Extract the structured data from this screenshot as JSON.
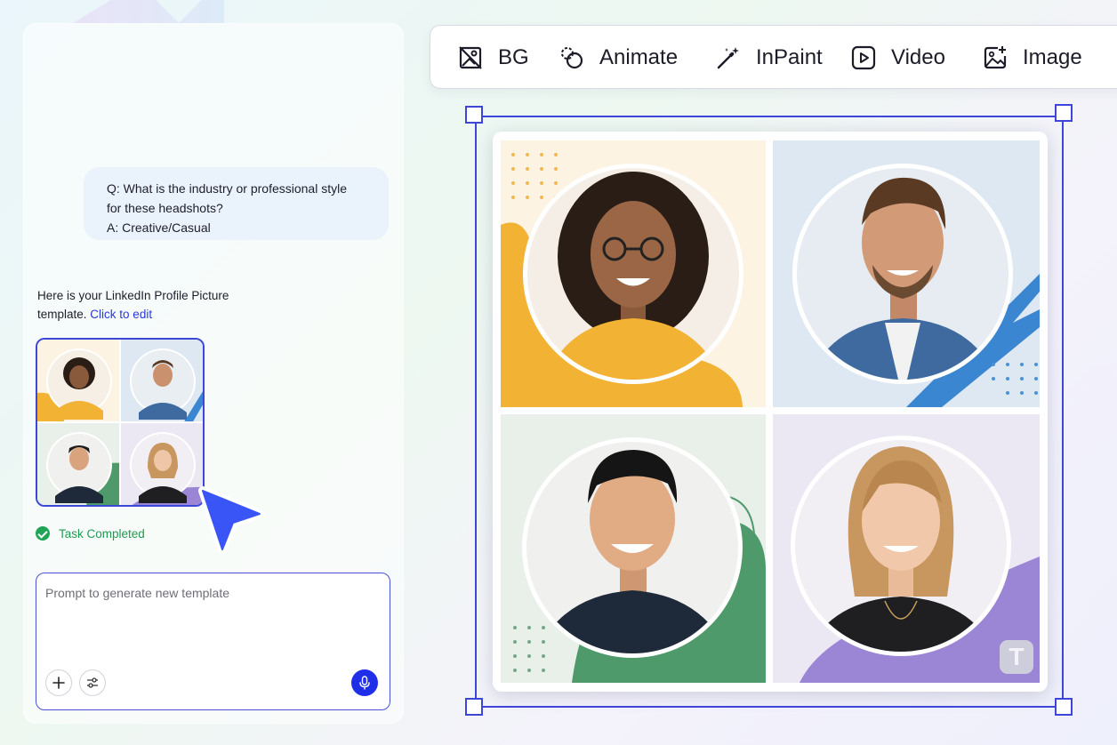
{
  "chat": {
    "question_line1": "Q: What is the industry or professional style",
    "question_line2": "for these headshots?",
    "answer_line": "A: Creative/Casual",
    "reply_line1": "Here is your LinkedIn Profile Picture",
    "reply_line2_prefix": "template.",
    "reply_link": "Click to edit",
    "task_status": "Task Completed",
    "prompt_placeholder": "Prompt to generate new template"
  },
  "toolbar": {
    "tools": [
      {
        "label": "BG",
        "icon": "background-remove-icon"
      },
      {
        "label": "Animate",
        "icon": "animate-icon"
      },
      {
        "label": "InPaint",
        "icon": "magic-wand-icon"
      },
      {
        "label": "Video",
        "icon": "video-play-icon"
      },
      {
        "label": "Image",
        "icon": "image-add-icon"
      }
    ]
  },
  "canvas": {
    "watermark_letter": "T",
    "portraits": [
      {
        "position": "top-left",
        "background": "#fdf3e3",
        "accent": "#f2b233"
      },
      {
        "position": "top-right",
        "background": "#dde8f3",
        "accent": "#3b86d1"
      },
      {
        "position": "bottom-left",
        "background": "#e9efe9",
        "accent": "#4f9a6b"
      },
      {
        "position": "bottom-right",
        "background": "#ebe7f3",
        "accent": "#9b86d6"
      }
    ]
  },
  "colors": {
    "accent": "#3e46d9",
    "mic_button": "#1f2ee8",
    "success": "#20a456"
  }
}
